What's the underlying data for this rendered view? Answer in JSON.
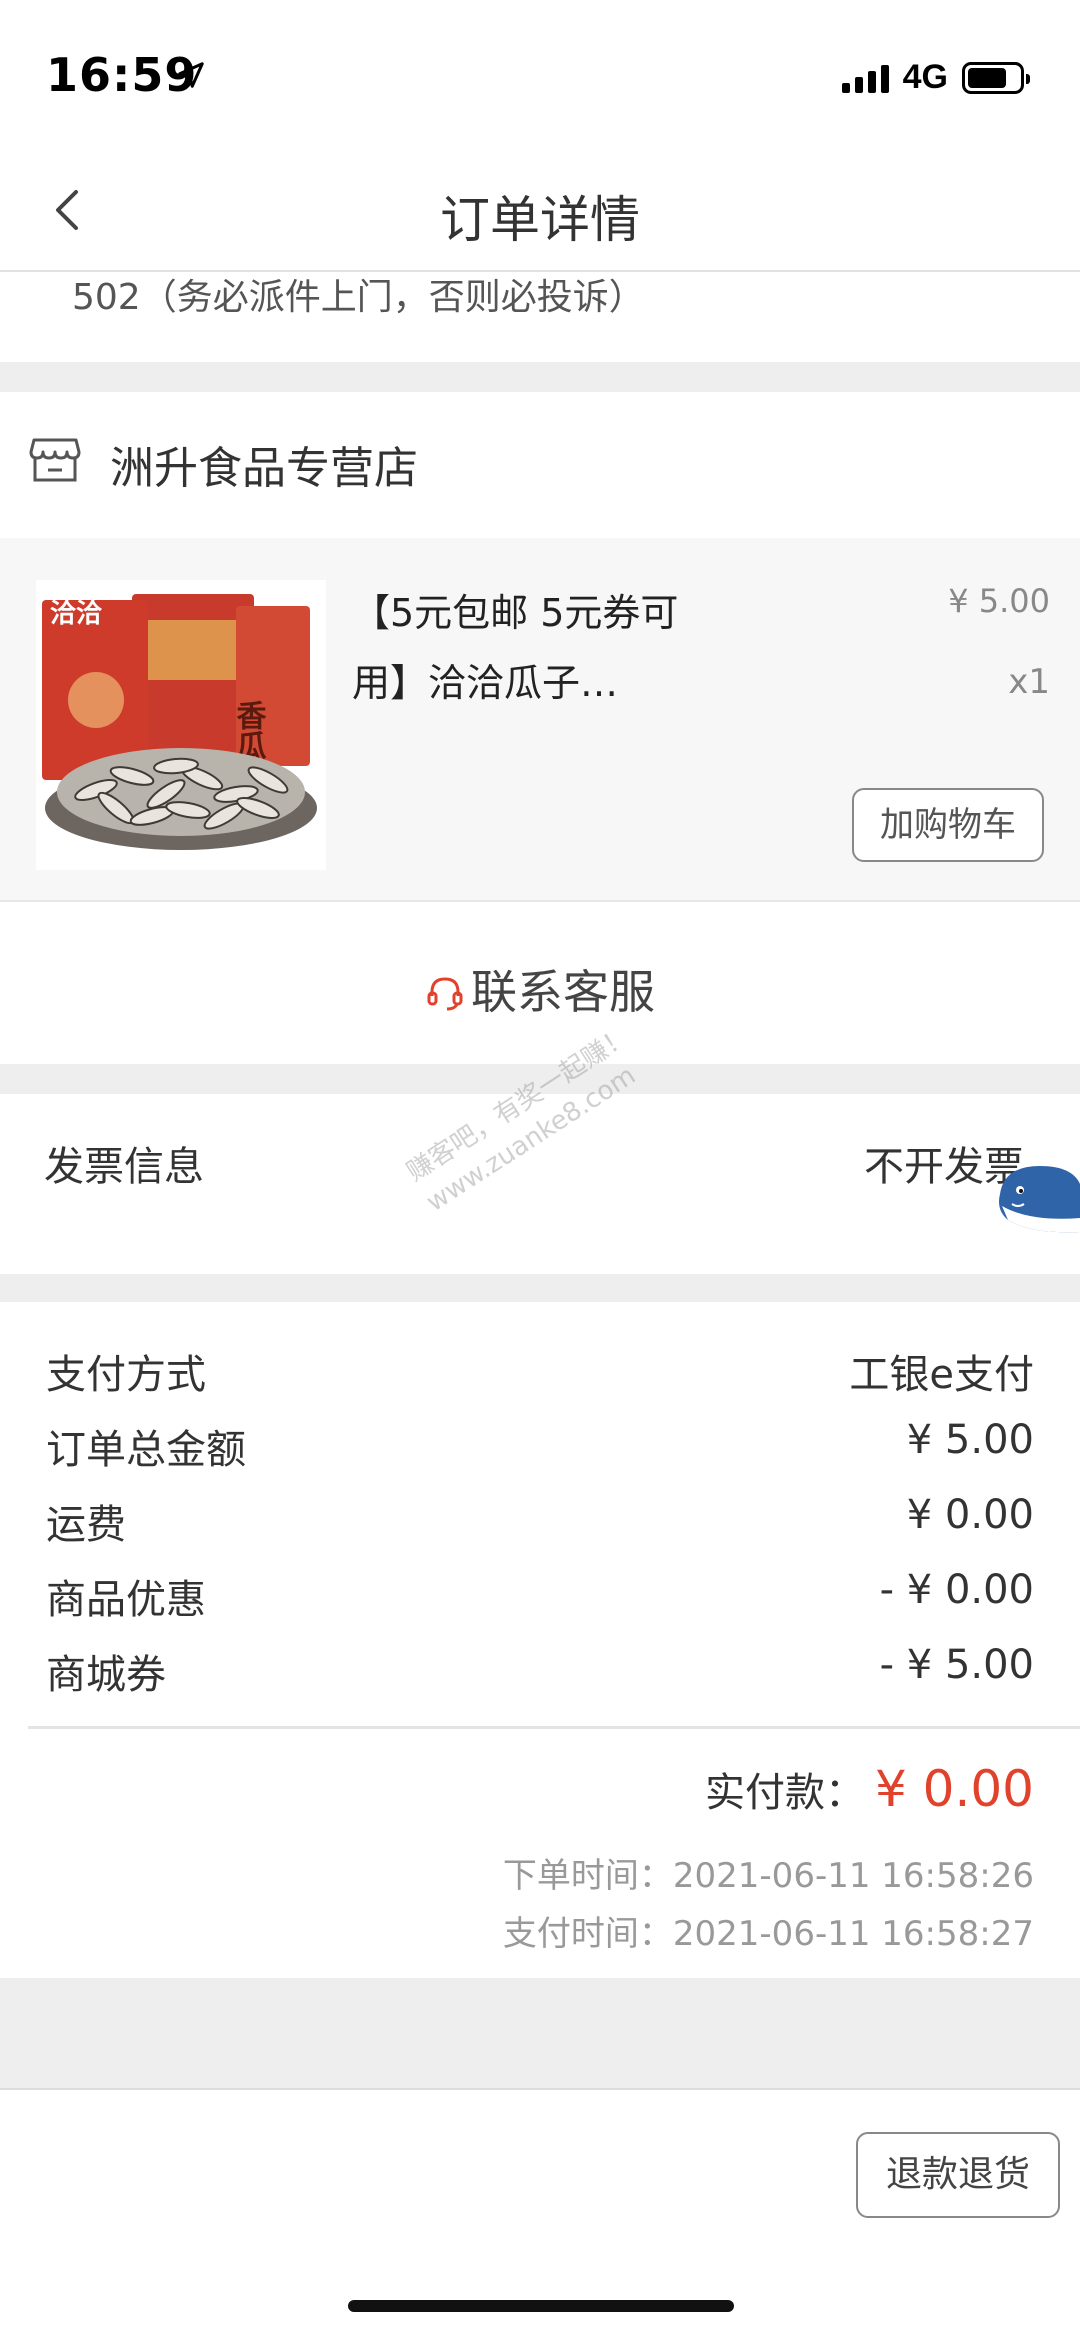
{
  "status_bar": {
    "time": "16:59",
    "network": "4G",
    "battery_level": 0.75
  },
  "nav": {
    "title": "订单详情"
  },
  "address": {
    "tail": "502（务必派件上门，否则必投诉）"
  },
  "shop": {
    "name": "洲升食品专营店"
  },
  "product": {
    "title": "【5元包邮 5元券可用】洽洽瓜子…",
    "price": "¥ 5.00",
    "qty": "x1",
    "image_brand": "洽洽",
    "image_text": "香瓜子",
    "add_cart_label": "加购物车"
  },
  "service": {
    "label": "联系客服"
  },
  "invoice": {
    "label": "发票信息",
    "value": "不开发票"
  },
  "watermark": {
    "line1": "赚客吧，有奖一起赚！",
    "line2": "www.zuanke8.com"
  },
  "payment": {
    "rows": [
      {
        "label": "支付方式",
        "value": "工银e支付"
      },
      {
        "label": "订单总金额",
        "value": "¥ 5.00"
      },
      {
        "label": "运费",
        "value": "¥ 0.00"
      },
      {
        "label": "商品优惠",
        "value": "- ¥ 0.00"
      },
      {
        "label": "商城券",
        "value": "- ¥ 5.00"
      }
    ],
    "total_label": "实付款：",
    "total_value": "¥ 0.00",
    "order_time": "下单时间：2021-06-11 16:58:26",
    "pay_time": "支付时间：2021-06-11 16:58:27"
  },
  "footer": {
    "refund_label": "退款退货"
  },
  "colors": {
    "accent_red": "#e0422c",
    "gray_bg": "#eeeeee"
  }
}
